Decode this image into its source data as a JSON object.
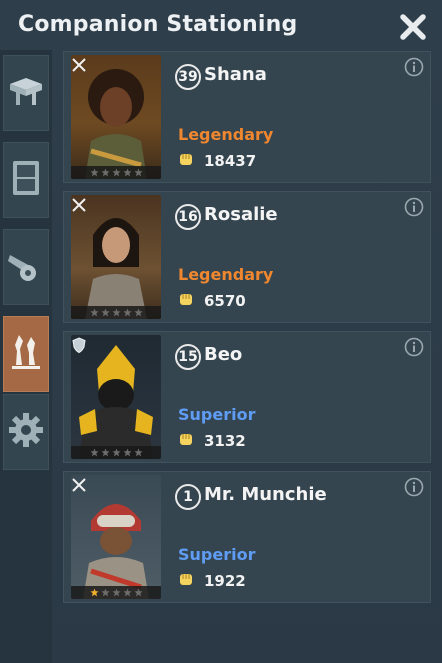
{
  "window": {
    "title": "Companion Stationing",
    "close_icon": "close-x-icon"
  },
  "sidebar": {
    "items": [
      {
        "name": "anvil",
        "icon": "anvil-icon",
        "active": false
      },
      {
        "name": "cabinet",
        "icon": "cabinet-icon",
        "active": false
      },
      {
        "name": "cannon",
        "icon": "cannon-icon",
        "active": false
      },
      {
        "name": "companions",
        "icon": "companion-stand-icon",
        "active": true
      },
      {
        "name": "settings",
        "icon": "gear-icon",
        "active": false
      }
    ]
  },
  "companions": [
    {
      "level": "39",
      "name": "Shana",
      "rarity": "Legendary",
      "rarity_color": "#f0872f",
      "power": "18437",
      "stars_filled": 0,
      "corner_icon": "crossed-swords-icon"
    },
    {
      "level": "16",
      "name": "Rosalie",
      "rarity": "Legendary",
      "rarity_color": "#f0872f",
      "power": "6570",
      "stars_filled": 0,
      "corner_icon": "crossed-swords-icon"
    },
    {
      "level": "15",
      "name": "Beo",
      "rarity": "Superior",
      "rarity_color": "#5f9cf4",
      "power": "3132",
      "stars_filled": 0,
      "corner_icon": "shield-icon"
    },
    {
      "level": "1",
      "name": "Mr. Munchie",
      "rarity": "Superior",
      "rarity_color": "#5f9cf4",
      "power": "1922",
      "stars_filled": 1,
      "corner_icon": "crossed-swords-icon"
    }
  ],
  "colors": {
    "star_filled": "#f0b02e",
    "star_empty": "#6d6d6d",
    "power_icon": "#f4d35e"
  }
}
